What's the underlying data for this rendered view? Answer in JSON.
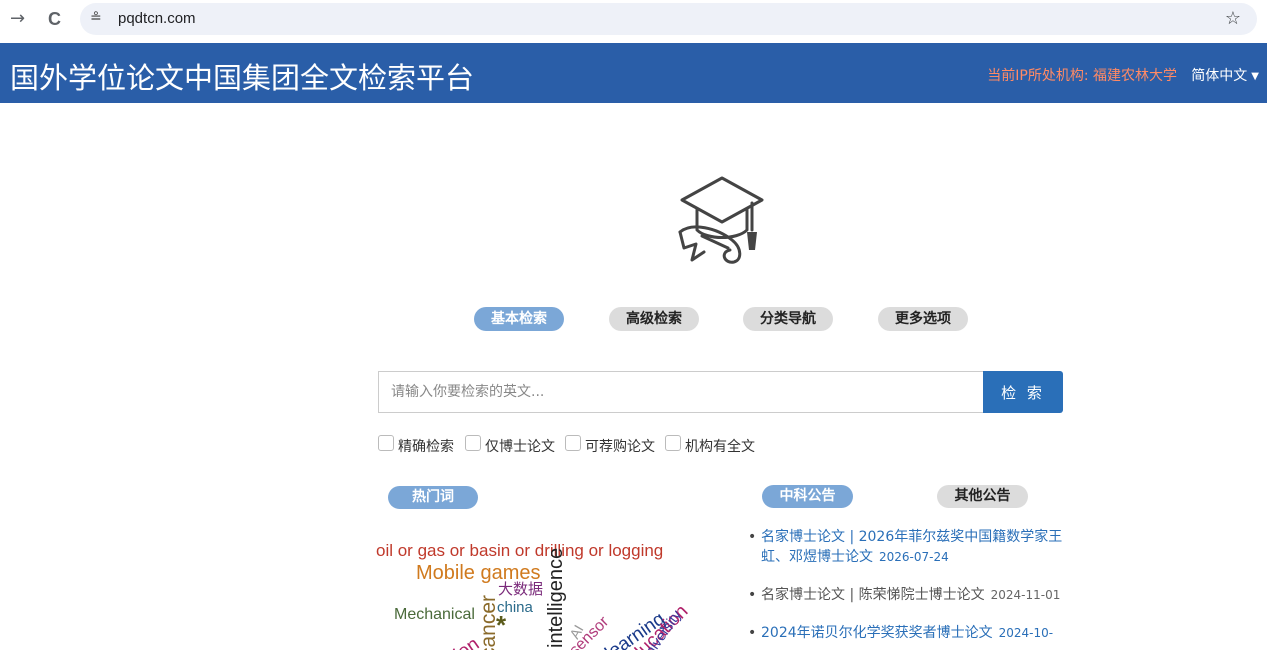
{
  "browser": {
    "back_icon": "→",
    "reload_icon": "C",
    "site_info_icon": "≗",
    "url": "pqdtcn.com",
    "bookmark_icon": "☆"
  },
  "header": {
    "title": "国外学位论文中国集团全文检索平台",
    "ip_info": "当前IP所处机构: 福建农林大学",
    "language": "简体中文",
    "colors": {
      "background": "#2a5ea8",
      "ip_text": "#ff8a65"
    }
  },
  "tabs": [
    {
      "label": "基本检索",
      "active": true
    },
    {
      "label": "高级检索",
      "active": false
    },
    {
      "label": "分类导航",
      "active": false
    },
    {
      "label": "更多选项",
      "active": false
    }
  ],
  "search": {
    "placeholder": "请输入你要检索的英文...",
    "button_label": "检 索"
  },
  "options": [
    {
      "label": "精确检索",
      "checked": false
    },
    {
      "label": "仅博士论文",
      "checked": false
    },
    {
      "label": "可荐购论文",
      "checked": false
    },
    {
      "label": "机构有全文",
      "checked": false
    }
  ],
  "hot_words": {
    "label": "热门词",
    "words": [
      {
        "text": "oil or gas or basin or drilling or logging",
        "color": "#c0392b"
      },
      {
        "text": "Mobile games",
        "color": "#d07a1e"
      },
      {
        "text": "大数据",
        "color": "#7a2a7a"
      },
      {
        "text": "Mechanical",
        "color": "#4a6a3a"
      },
      {
        "text": "china",
        "color": "#2a6a8a"
      },
      {
        "text": "intelligence",
        "color": "#222222"
      },
      {
        "text": "cancer",
        "color": "#8a6a2a"
      },
      {
        "text": "AI",
        "color": "#9a9a9a"
      },
      {
        "text": "sensor",
        "color": "#b03a7a"
      },
      {
        "text": "learning",
        "color": "#1a3a8a"
      },
      {
        "text": "education",
        "color": "#b0206a"
      },
      {
        "text": "university",
        "color": "#3a3a9a"
      },
      {
        "text": "ation",
        "color": "#b0206a"
      },
      {
        "text": "*",
        "color": "#5a5a1a"
      }
    ]
  },
  "notices": {
    "tabs": [
      {
        "label": "中科公告",
        "active": true
      },
      {
        "label": "其他公告",
        "active": false
      }
    ],
    "items": [
      {
        "title": "名家博士论文 | 2026年菲尔兹奖中国籍数学家王虹、邓煜博士论文",
        "date": "2026-07-24",
        "highlight": true
      },
      {
        "title": "名家博士论文 | 陈荣悌院士博士论文",
        "date": "2024-11-01",
        "highlight": false
      },
      {
        "title": "2024年诺贝尔化学奖获奖者博士论文",
        "date": "2024-10-",
        "highlight": true
      }
    ]
  }
}
